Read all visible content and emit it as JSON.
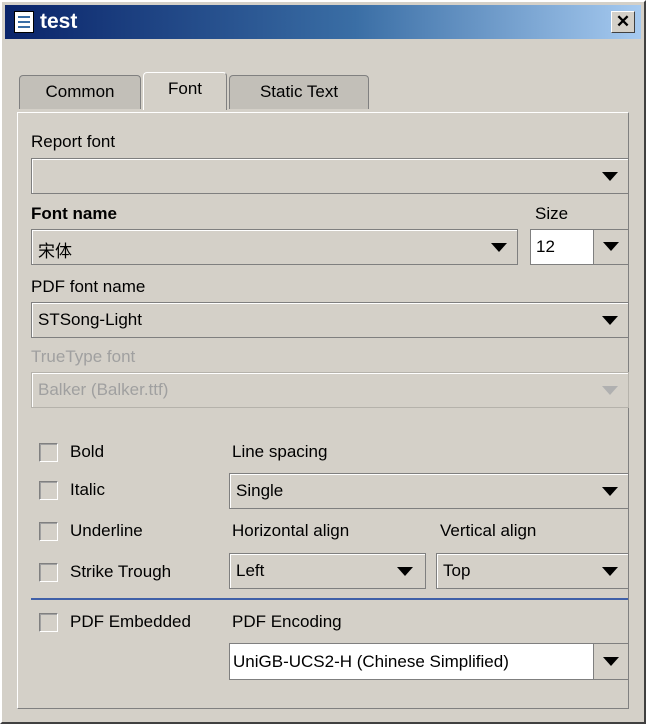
{
  "window": {
    "title": "test",
    "close_glyph": "✕"
  },
  "tabs": [
    {
      "label": "Common",
      "active": false
    },
    {
      "label": "Font",
      "active": true
    },
    {
      "label": "Static Text",
      "active": false
    }
  ],
  "report_font": {
    "label": "Report font",
    "value": ""
  },
  "font_name": {
    "label": "Font name",
    "value": "宋体"
  },
  "size": {
    "label": "Size",
    "value": "12"
  },
  "pdf_font_name": {
    "label": "PDF font name",
    "value": "STSong-Light"
  },
  "truetype_font": {
    "label": "TrueType font",
    "value": "Balker (Balker.ttf)",
    "disabled": true
  },
  "styles": {
    "bold": {
      "label": "Bold",
      "checked": false
    },
    "italic": {
      "label": "Italic",
      "checked": false
    },
    "underline": {
      "label": "Underline",
      "checked": false
    },
    "strike": {
      "label": "Strike Trough",
      "checked": false
    }
  },
  "line_spacing": {
    "label": "Line spacing",
    "value": "Single"
  },
  "horizontal_align": {
    "label": "Horizontal align",
    "value": "Left"
  },
  "vertical_align": {
    "label": "Vertical align",
    "value": "Top"
  },
  "pdf_embedded": {
    "label": "PDF Embedded",
    "checked": false
  },
  "pdf_encoding": {
    "label": "PDF Encoding",
    "value": "UniGB-UCS2-H (Chinese Simplified)"
  },
  "colors": {
    "titlebar_start": "#0a246a",
    "titlebar_end": "#a6caf0",
    "dialog_bg": "#d4d0c8",
    "separator": "#4060a8"
  },
  "icons": [
    "app-icon",
    "close-icon",
    "chevron-down-icon"
  ]
}
